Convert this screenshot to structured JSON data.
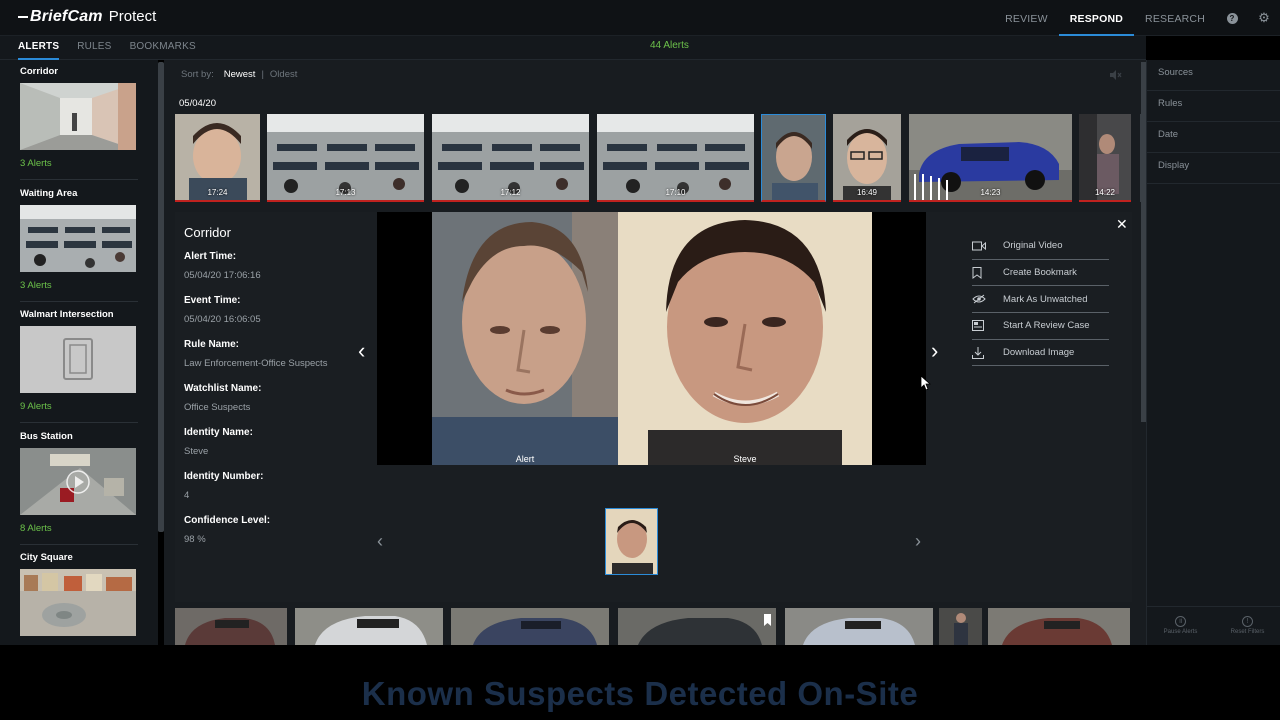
{
  "app": {
    "brand": "BriefCam",
    "product": "Protect"
  },
  "topnav": {
    "items": [
      {
        "label": "REVIEW",
        "active": false
      },
      {
        "label": "RESPOND",
        "active": true
      },
      {
        "label": "RESEARCH",
        "active": false
      }
    ],
    "icons": [
      "help-icon",
      "gear-icon"
    ]
  },
  "subnav": {
    "tabs": [
      {
        "label": "ALERTS",
        "active": true
      },
      {
        "label": "RULES",
        "active": false
      },
      {
        "label": "BOOKMARKS",
        "active": false
      }
    ],
    "alert_count": "44 Alerts"
  },
  "cameras": [
    {
      "name": "Corridor",
      "alerts": "3 Alerts"
    },
    {
      "name": "Waiting Area",
      "alerts": "3 Alerts"
    },
    {
      "name": "Walmart Intersection",
      "alerts": "9 Alerts"
    },
    {
      "name": "Bus Station",
      "alerts": "8 Alerts"
    },
    {
      "name": "City Square",
      "alerts": ""
    }
  ],
  "sort": {
    "label": "Sort by:",
    "options": [
      "Newest",
      "Oldest"
    ],
    "active": "Newest"
  },
  "date": "05/04/20",
  "strip": [
    {
      "time": "17:24",
      "scene": "face-down"
    },
    {
      "time": "17:13",
      "scene": "waiting-area"
    },
    {
      "time": "17:12",
      "scene": "waiting-area"
    },
    {
      "time": "17:10",
      "scene": "waiting-area"
    },
    {
      "time": "",
      "scene": "face",
      "selected": true
    },
    {
      "time": "16:49",
      "scene": "face-glasses"
    },
    {
      "time": "14:23",
      "scene": "blue-car"
    },
    {
      "time": "14:22",
      "scene": "person"
    }
  ],
  "detail": {
    "title": "Corridor",
    "fields": [
      {
        "label": "Alert Time:",
        "value": "05/04/20 17:06:16"
      },
      {
        "label": "Event Time:",
        "value": "05/04/20  16:06:05"
      },
      {
        "label": "Rule Name:",
        "value": "Law Enforcement-Office Suspects"
      },
      {
        "label": "Watchlist Name:",
        "value": "Office Suspects"
      },
      {
        "label": "Identity Name:",
        "value": "Steve"
      },
      {
        "label": "Identity Number:",
        "value": "4"
      },
      {
        "label": "Confidence Level:",
        "value": "98 %"
      }
    ],
    "viewer": {
      "left_caption": "Alert",
      "right_caption": "Steve"
    },
    "actions": [
      {
        "label": "Original Video",
        "icon": "video-icon"
      },
      {
        "label": "Create Bookmark",
        "icon": "bookmark-icon"
      },
      {
        "label": "Mark As Unwatched",
        "icon": "eye-icon"
      },
      {
        "label": "Start A Review Case",
        "icon": "case-icon"
      },
      {
        "label": "Download Image",
        "icon": "download-icon"
      }
    ]
  },
  "filters": {
    "items": [
      "Sources",
      "Rules",
      "Date",
      "Display"
    ],
    "pause": "Pause Alerts",
    "reset": "Reset Filters"
  },
  "caption": "Known Suspects Detected On-Site",
  "colors": {
    "accent": "#2b8bd8",
    "alert_green": "#6cc24a",
    "alert_red": "#c0221f"
  }
}
